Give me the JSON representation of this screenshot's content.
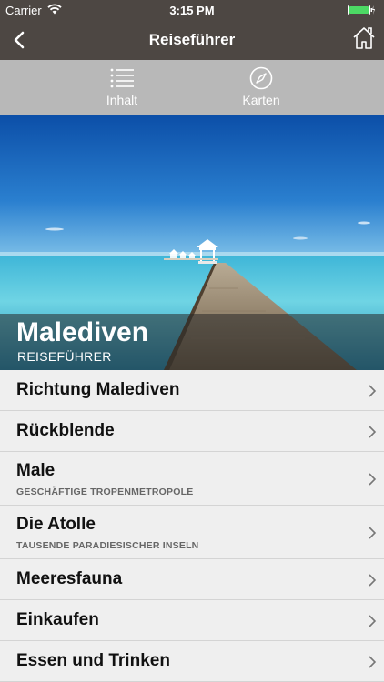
{
  "status_bar": {
    "carrier": "Carrier",
    "time": "3:15 PM"
  },
  "nav": {
    "title": "Reiseführer",
    "back_icon": "chevron-left-icon",
    "home_icon": "home-icon"
  },
  "tabs": [
    {
      "label": "Inhalt",
      "icon": "list-icon"
    },
    {
      "label": "Karten",
      "icon": "compass-icon"
    }
  ],
  "hero": {
    "title": "Malediven",
    "subtitle": "REISEFÜHRER"
  },
  "list": [
    {
      "title": "Richtung Malediven",
      "subtitle": ""
    },
    {
      "title": "Rückblende",
      "subtitle": ""
    },
    {
      "title": "Male",
      "subtitle": "GESCHÄFTIGE TROPENMETROPOLE"
    },
    {
      "title": "Die Atolle",
      "subtitle": "TAUSENDE PARADIESISCHER INSELN"
    },
    {
      "title": "Meeresfauna",
      "subtitle": ""
    },
    {
      "title": "Einkaufen",
      "subtitle": ""
    },
    {
      "title": "Essen und Trinken",
      "subtitle": ""
    }
  ],
  "colors": {
    "bar": "#4d4743",
    "tabbar": "#b8b8b8",
    "list_bg": "#efefef",
    "battery": "#4cd964"
  }
}
